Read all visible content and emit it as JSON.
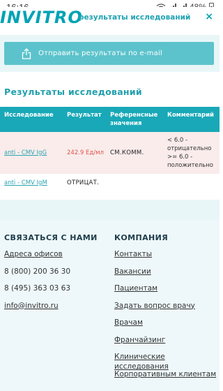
{
  "status_bar": {
    "time": "16:16",
    "battery": "48%"
  },
  "header": {
    "logo": "INVITRO",
    "title": "результаты исследований",
    "close": "×"
  },
  "actions": {
    "send_label": "Отправить результаты по e-mail"
  },
  "results": {
    "title": "Результаты исследований",
    "columns": [
      "Исследование",
      "Результат",
      "Референсные значения",
      "Комментарий"
    ],
    "rows": [
      {
        "test": "anti - CMV IgG",
        "result": "242.9 Ед/мл",
        "reference": "СМ.КОММ.",
        "comment": "< 6.0 - отрицательно >= 6.0 - положительно"
      },
      {
        "test": "anti - CMV IgM",
        "result": "ОТРИЦАТ.",
        "reference": "",
        "comment": ""
      }
    ]
  },
  "footer": {
    "contact_title": "СВЯЗАТЬСЯ С НАМИ",
    "contact_items": [
      "Адреса офисов",
      "8 (800) 200 36 30",
      "8 (495) 363 03 63",
      "info@invitro.ru"
    ],
    "company_title": "КОМПАНИЯ",
    "company_items": [
      "Контакты",
      "Вакансии",
      "Пациентам",
      "Задать вопрос врачу",
      "Врачам",
      "Франчайзинг",
      "Клинические исследования",
      "Корпоративным клиентам"
    ]
  },
  "colors": {
    "accent": "#19a8b7",
    "button": "#5cc3cc",
    "highlight_row": "#f9eceb",
    "result_red": "#e0534a"
  }
}
